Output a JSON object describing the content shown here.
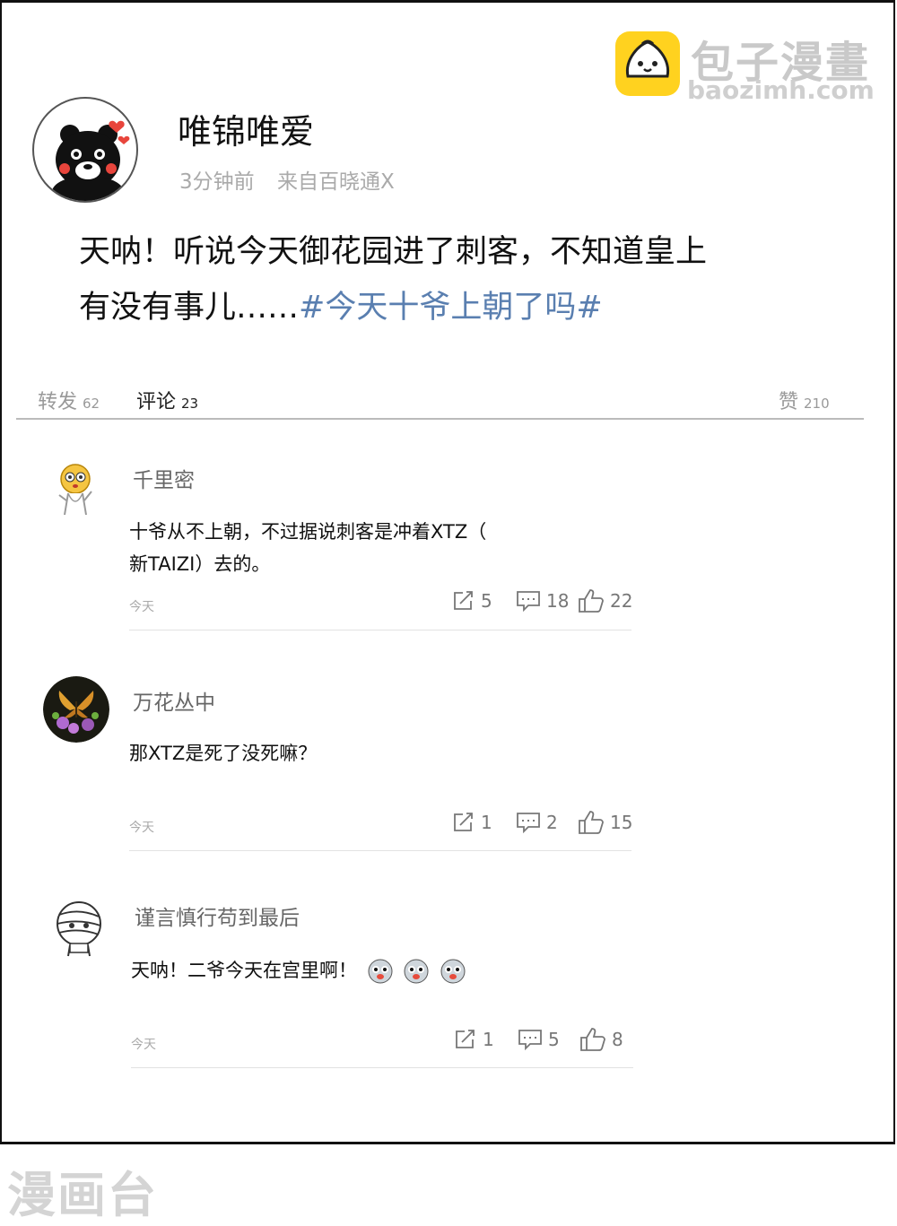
{
  "watermark": {
    "name": "包子漫畫",
    "url": "baozimh.com",
    "bottom": "漫画台"
  },
  "post": {
    "username": "唯锦唯爱",
    "time": "3分钟前",
    "source": "来自百晓通X",
    "body_line1": "天呐！听说今天御花园进了刺客，不知道皇上",
    "body_line2_plain": "有没有事儿……",
    "hashtag": "#今天十爷上朝了吗#"
  },
  "tabs": {
    "repost_label": "转发",
    "repost_count": "62",
    "comment_label": "评论",
    "comment_count": "23",
    "like_label": "赞",
    "like_count": "210"
  },
  "comments": [
    {
      "name": "千里密",
      "text_line1": "十爷从不上朝，不过据说刺客是冲着XTZ（",
      "text_line2": "新TAIZI）去的。",
      "time": "今天",
      "shares": "5",
      "replies": "18",
      "likes": "22"
    },
    {
      "name": "万花丛中",
      "text_line1": "那XTZ是死了没死嘛？",
      "time": "今天",
      "shares": "1",
      "replies": "2",
      "likes": "15"
    },
    {
      "name": "谨言慎行苟到最后",
      "text_line1": "天呐！二爷今天在宫里啊！",
      "time": "今天",
      "shares": "1",
      "replies": "5",
      "likes": "8"
    }
  ],
  "colors": {
    "hashtag": "#5a7fb0",
    "logo_yellow": "#ffd21f"
  }
}
